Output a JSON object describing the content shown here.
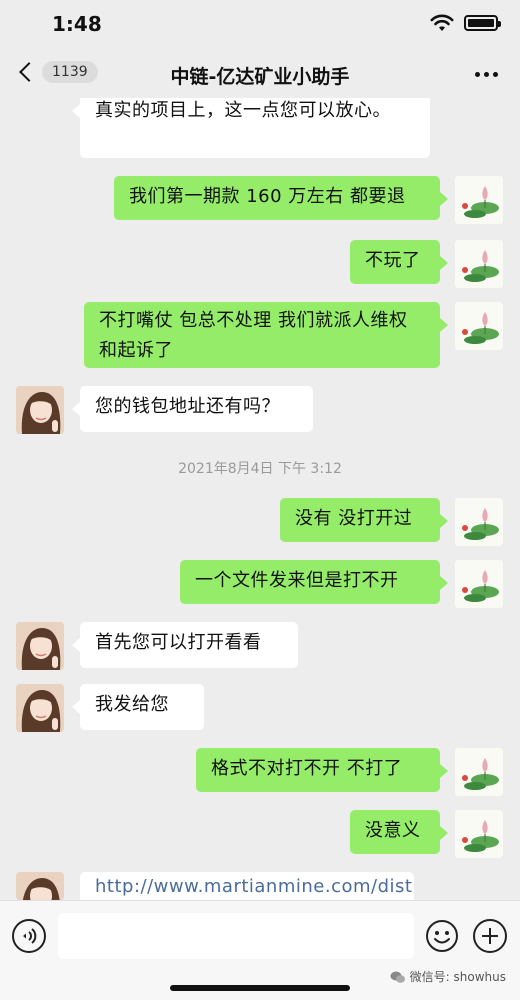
{
  "status_bar": {
    "time": "1:48"
  },
  "nav": {
    "unread_count": "1139",
    "title": "中链-亿达矿业小助手"
  },
  "messages": [
    {
      "side": "recv",
      "text": "真实的项目上，这一点您可以放心。"
    },
    {
      "side": "sent",
      "text": "我们第一期款 160 万左右 都要退"
    },
    {
      "side": "sent",
      "text": "不玩了"
    },
    {
      "side": "sent",
      "text": "不打嘴仗 包总不处理 我们就派人维权和起诉了"
    },
    {
      "side": "recv",
      "text": "您的钱包地址还有吗？"
    },
    {
      "side": "sent",
      "text": "没有 没打开过"
    },
    {
      "side": "sent",
      "text": "一个文件发来但是打不开"
    },
    {
      "side": "recv",
      "text": "首先您可以打开看看"
    },
    {
      "side": "recv",
      "text": "我发给您"
    },
    {
      "side": "sent",
      "text": "格式不对打不开 不打了"
    },
    {
      "side": "sent",
      "text": "没意义"
    },
    {
      "side": "recv",
      "text": "http://www.martianmine.com/dist"
    }
  ],
  "timestamp": "2021年8月4日 下午 3:12",
  "input": {
    "placeholder": ""
  },
  "watermark": "微信号: showhus",
  "icons": {
    "back": "chevron-left-icon",
    "more": "more-dots-icon",
    "voice": "voice-icon",
    "emoji": "emoji-icon",
    "plus": "plus-icon",
    "wifi": "wifi-icon",
    "battery": "battery-icon"
  },
  "colors": {
    "sent_bubble": "#95ec69",
    "recv_bubble": "#ffffff",
    "background": "#ededed",
    "link": "#4a6c9a"
  }
}
